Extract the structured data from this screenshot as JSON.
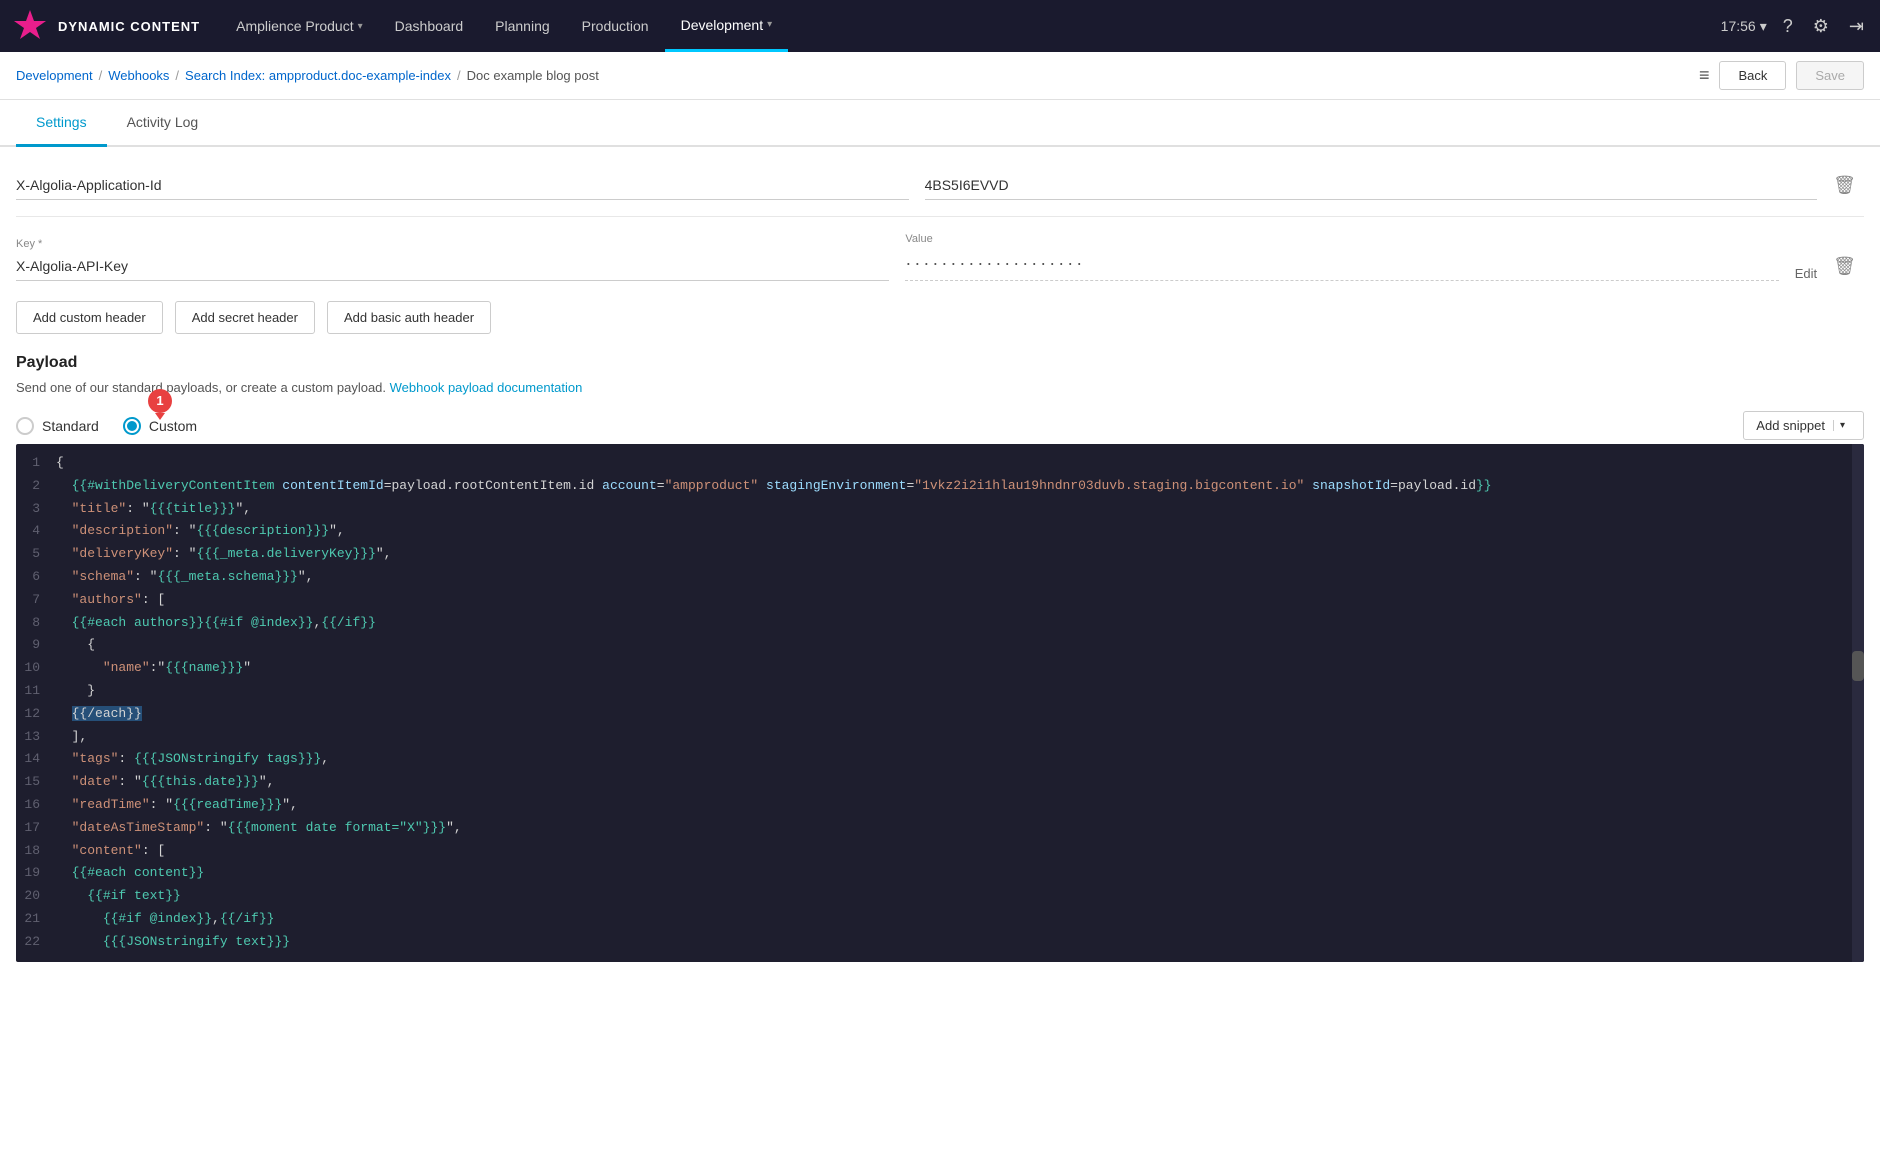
{
  "brand": {
    "name": "DYNAMIC CONTENT"
  },
  "nav": {
    "items": [
      {
        "label": "Amplience Product",
        "hasDropdown": true,
        "active": false
      },
      {
        "label": "Dashboard",
        "hasDropdown": false,
        "active": false
      },
      {
        "label": "Planning",
        "hasDropdown": false,
        "active": false
      },
      {
        "label": "Production",
        "hasDropdown": false,
        "active": false
      },
      {
        "label": "Development",
        "hasDropdown": true,
        "active": true
      }
    ],
    "time": "17:56",
    "hasTimeDropdown": true
  },
  "breadcrumb": {
    "items": [
      {
        "label": "Development",
        "isLink": true
      },
      {
        "label": "Webhooks",
        "isLink": true
      },
      {
        "label": "Search Index: ampproduct.doc-example-index",
        "isLink": true
      },
      {
        "label": "Doc example blog post",
        "isLink": false
      }
    ]
  },
  "actions": {
    "back_label": "Back",
    "save_label": "Save"
  },
  "tabs": {
    "items": [
      {
        "label": "Settings",
        "active": true
      },
      {
        "label": "Activity Log",
        "active": false
      }
    ]
  },
  "headers": [
    {
      "key_label": "",
      "key_value": "X-Algolia-Application-Id",
      "value_label": "",
      "value_value": "4BS5I6EVVD",
      "has_edit": false
    },
    {
      "key_label": "Key *",
      "key_value": "X-Algolia-API-Key",
      "value_label": "Value",
      "value_value": "••••••••••••••••••••",
      "has_edit": true
    }
  ],
  "buttons": {
    "add_custom_label": "Add custom header",
    "add_secret_label": "Add secret header",
    "add_basic_label": "Add basic auth header"
  },
  "payload": {
    "title": "Payload",
    "description": "Send one of our standard payloads, or create a custom payload.",
    "doc_link_label": "Webhook payload documentation",
    "radio_standard_label": "Standard",
    "radio_custom_label": "Custom",
    "add_snippet_label": "Add snippet",
    "badge_number": "1"
  },
  "code_lines": [
    {
      "num": 1,
      "content": "{"
    },
    {
      "num": 2,
      "content": "  {{#withDeliveryContentItem contentItemId=payload.rootContentItem.id account=\"ampproduct\" stagingEnvironment=\"1vkz2i2i1hlau19hndnr03duvb.staging.bigcontent.io\" snapshotId=payload.id}}"
    },
    {
      "num": 3,
      "content": "  \"title\": \"{{{title}}}\","
    },
    {
      "num": 4,
      "content": "  \"description\": \"{{{description}}}\","
    },
    {
      "num": 5,
      "content": "  \"deliveryKey\": \"{{{_meta.deliveryKey}}}\","
    },
    {
      "num": 6,
      "content": "  \"schema\": \"{{{_meta.schema}}}\","
    },
    {
      "num": 7,
      "content": "  \"authors\": ["
    },
    {
      "num": 8,
      "content": "  {{#each authors}}{{#if @index}},{{/if}}"
    },
    {
      "num": 9,
      "content": "    {"
    },
    {
      "num": 10,
      "content": "      \"name\":\"{{{name}}}\""
    },
    {
      "num": 11,
      "content": "    }"
    },
    {
      "num": 12,
      "content": "  {{/each}}",
      "selected": true
    },
    {
      "num": 13,
      "content": "  ],"
    },
    {
      "num": 14,
      "content": "  \"tags\": {{{JSONstringify tags}}},"
    },
    {
      "num": 15,
      "content": "  \"date\": \"{{{this.date}}}\","
    },
    {
      "num": 16,
      "content": "  \"readTime\": \"{{{readTime}}}\","
    },
    {
      "num": 17,
      "content": "  \"dateAsTimeStamp\": \"{{{moment date format=\"X\"}}}\","
    },
    {
      "num": 18,
      "content": "  \"content\": ["
    },
    {
      "num": 19,
      "content": "  {{#each content}}"
    },
    {
      "num": 20,
      "content": "    {{#if text}}"
    },
    {
      "num": 21,
      "content": "      {{#if @index}},{{/if}}"
    },
    {
      "num": 22,
      "content": "      {{{JSONstringify text}}}"
    }
  ]
}
